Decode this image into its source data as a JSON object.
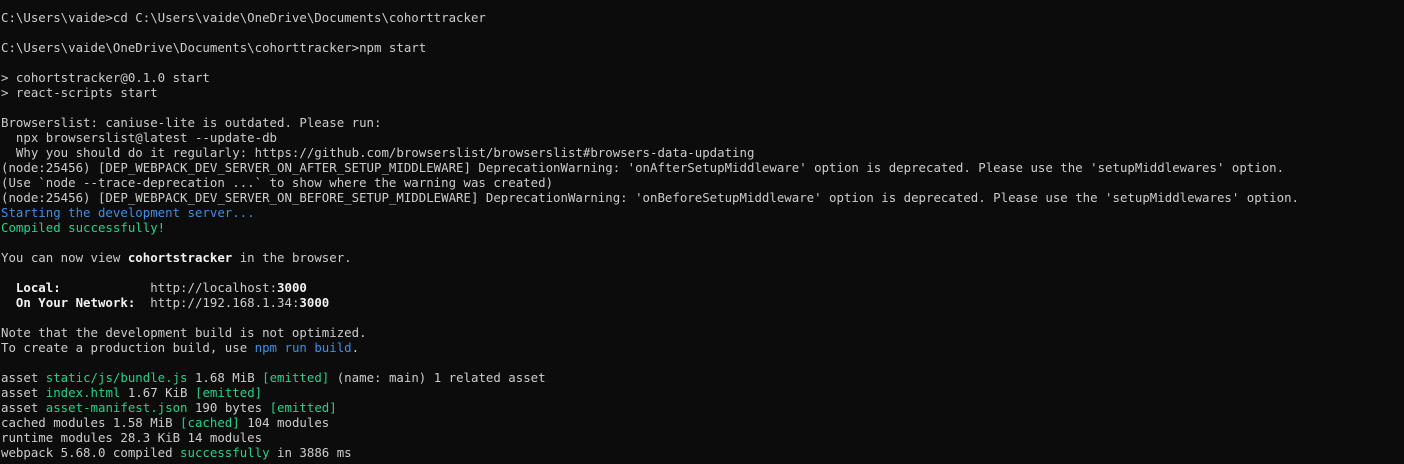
{
  "terminal": {
    "prompt1": "C:\\Users\\vaide>cd C:\\Users\\vaide\\OneDrive\\Documents\\cohorttracker",
    "prompt2": "C:\\Users\\vaide\\OneDrive\\Documents\\cohorttracker>npm start",
    "script1": "> cohortstracker@0.1.0 start",
    "script2": "> react-scripts start",
    "browserslist1": "Browserslist: caniuse-lite is outdated. Please run:",
    "browserslist2": "  npx browserslist@latest --update-db",
    "browserslist3": "  Why you should do it regularly: https://github.com/browserslist/browserslist#browsers-data-updating",
    "warn1": "(node:25456) [DEP_WEBPACK_DEV_SERVER_ON_AFTER_SETUP_MIDDLEWARE] DeprecationWarning: 'onAfterSetupMiddleware' option is deprecated. Please use the 'setupMiddlewares' option.",
    "warn2": "(Use `node --trace-deprecation ...` to show where the warning was created)",
    "warn3": "(node:25456) [DEP_WEBPACK_DEV_SERVER_ON_BEFORE_SETUP_MIDDLEWARE] DeprecationWarning: 'onBeforeSetupMiddleware' option is deprecated. Please use the 'setupMiddlewares' option.",
    "starting": "Starting the development server...",
    "compiled": "Compiled successfully!",
    "view_prefix": "You can now view ",
    "app_name": "cohortstracker",
    "view_suffix": " in the browser.",
    "local_label": "  Local:",
    "local_pad": "            ",
    "local_url": "http://localhost:",
    "local_port": "3000",
    "network_label": "  On Your Network:",
    "network_pad": "  ",
    "network_url": "http://192.168.1.34:",
    "network_port": "3000",
    "note1": "Note that the development build is not optimized.",
    "note2_prefix": "To create a production build, use ",
    "note2_cmd": "npm run build",
    "note2_suffix": ".",
    "asset1_prefix": "asset ",
    "asset1_name": "static/js/bundle.js",
    "asset1_size": " 1.68 MiB ",
    "asset1_tag": "[emitted]",
    "asset1_suffix": " (name: main) 1 related asset",
    "asset2_prefix": "asset ",
    "asset2_name": "index.html",
    "asset2_size": " 1.67 KiB ",
    "asset2_tag": "[emitted]",
    "asset3_prefix": "asset ",
    "asset3_name": "asset-manifest.json",
    "asset3_size": " 190 bytes ",
    "asset3_tag": "[emitted]",
    "cached_prefix": "cached modules 1.58 MiB ",
    "cached_tag": "[cached]",
    "cached_suffix": " 104 modules",
    "runtime": "runtime modules 28.3 KiB 14 modules",
    "webpack_prefix": "webpack 5.68.0 compiled ",
    "webpack_status": "successfully",
    "webpack_suffix": " in 3886 ms"
  },
  "colors": {
    "background": "#0c0c0c",
    "text": "#cccccc",
    "info_blue": "#3b8eea",
    "success_green": "#23d18b"
  }
}
